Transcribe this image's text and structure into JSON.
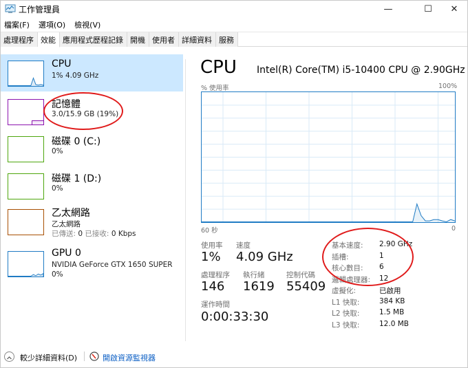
{
  "window": {
    "title": "工作管理員",
    "controls": {
      "minimize": "—",
      "maximize": "☐",
      "close": "✕"
    }
  },
  "menu": [
    "檔案(F)",
    "選項(O)",
    "檢視(V)"
  ],
  "tabs": [
    {
      "label": "處理程序",
      "active": false
    },
    {
      "label": "效能",
      "active": true
    },
    {
      "label": "應用程式歷程記錄",
      "active": false
    },
    {
      "label": "開機",
      "active": false
    },
    {
      "label": "使用者",
      "active": false
    },
    {
      "label": "詳細資料",
      "active": false
    },
    {
      "label": "服務",
      "active": false
    }
  ],
  "sidebar": {
    "items": [
      {
        "title": "CPU",
        "sub1": "1% 4.09 GHz",
        "color": "#1f7bc4",
        "selected": true
      },
      {
        "title": "記憶體",
        "sub1": "3.0/15.9 GB (19%)",
        "color": "#8b12ae",
        "selected": false
      },
      {
        "title": "磁碟 0 (C:)",
        "sub1": "0%",
        "color": "#4da60c",
        "selected": false
      },
      {
        "title": "磁碟 1 (D:)",
        "sub1": "0%",
        "color": "#4da60c",
        "selected": false
      },
      {
        "title": "乙太網路",
        "sub1": "乙太網路",
        "sent_label": "已傳送:",
        "sent_value": "0",
        "recv_label": "已接收:",
        "recv_value": "0 Kbps",
        "color": "#a74f01",
        "selected": false
      },
      {
        "title": "GPU 0",
        "sub1": "NVIDIA GeForce GTX 1650 SUPER",
        "sub2": "0%",
        "color": "#1f7bc4",
        "selected": false
      }
    ]
  },
  "main": {
    "title": "CPU",
    "model": "Intel(R) Core(TM) i5-10400 CPU @ 2.90GHz",
    "graph": {
      "y_label": "% 使用率",
      "y_max_label": "100%",
      "x_left_label": "60 秒",
      "x_right_label": "0"
    },
    "stats": {
      "utilization": {
        "label": "使用率",
        "value": "1%"
      },
      "speed": {
        "label": "速度",
        "value": "4.09 GHz"
      },
      "processes": {
        "label": "處理程序",
        "value": "146"
      },
      "threads": {
        "label": "執行緒",
        "value": "1619"
      },
      "handles": {
        "label": "控制代碼",
        "value": "55409"
      },
      "uptime": {
        "label": "運作時間",
        "value": "0:00:33:30"
      }
    },
    "specs": [
      {
        "label": "基本速度:",
        "value": "2.90 GHz"
      },
      {
        "label": "插槽:",
        "value": "1"
      },
      {
        "label": "核心數目:",
        "value": "6"
      },
      {
        "label": "邏輯處理器:",
        "value": "12"
      },
      {
        "label": "虛擬化:",
        "value": "已啟用"
      },
      {
        "label": "L1 快取:",
        "value": "384 KB"
      },
      {
        "label": "L2 快取:",
        "value": "1.5 MB"
      },
      {
        "label": "L3 快取:",
        "value": "12.0 MB"
      }
    ]
  },
  "footer": {
    "fewer_details": "較少詳細資料(D)",
    "open_resmon": "開啟資源監視器"
  },
  "chart_data": {
    "type": "area",
    "title": "CPU",
    "ylabel": "% 使用率",
    "xlabel": "60 秒",
    "ylim": [
      0,
      100
    ],
    "xlim": [
      60,
      0
    ],
    "grid": true,
    "x": [
      60,
      58,
      56,
      54,
      52,
      50,
      48,
      46,
      44,
      42,
      40,
      38,
      36,
      34,
      32,
      30,
      28,
      26,
      24,
      22,
      20,
      18,
      16,
      14,
      12,
      10,
      9,
      8,
      7,
      6,
      5,
      4,
      3,
      2,
      1,
      0
    ],
    "series": [
      {
        "name": "CPU",
        "values": [
          0,
          0,
          0,
          0,
          0,
          0,
          0,
          0,
          0,
          0,
          0,
          0,
          0,
          0,
          0,
          0,
          0,
          0,
          0,
          0,
          0,
          0,
          0,
          0,
          0,
          0,
          14,
          5,
          1,
          1,
          2,
          2,
          1,
          0,
          2,
          1
        ]
      }
    ],
    "sparklines": {
      "cpu": [
        0,
        0,
        0,
        0,
        0,
        0,
        0,
        0,
        0,
        0,
        14,
        2,
        1,
        2,
        1
      ],
      "memory": 19,
      "gpu": [
        0,
        0,
        0,
        0,
        0,
        0,
        0,
        0,
        0,
        0,
        3,
        1,
        4,
        2,
        5
      ]
    }
  }
}
